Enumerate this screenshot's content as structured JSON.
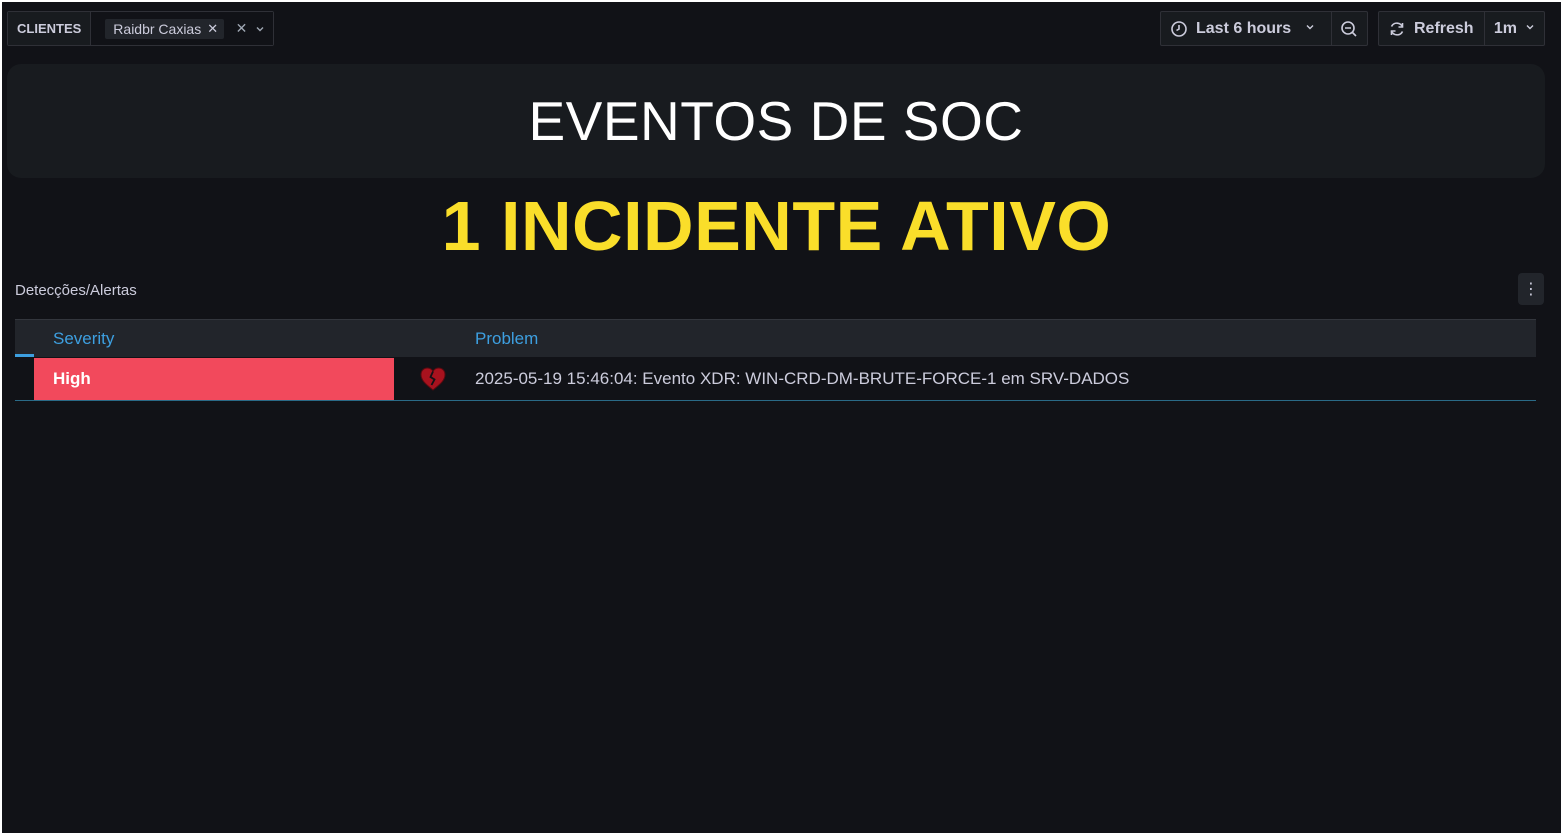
{
  "toolbar": {
    "variable_label": "CLIENTES",
    "variable_value": "Raidbr Caxias",
    "chip_remove": "✕",
    "clear_icon": "✕",
    "dropdown_icon": "⌄",
    "time_range": "Last 6 hours",
    "refresh_label": "Refresh",
    "refresh_interval": "1m"
  },
  "icons": {
    "clock": "clock-icon",
    "zoom_out": "zoom-out-icon",
    "refresh": "sync-icon",
    "severity": "broken-heart-icon"
  },
  "title_panel": {
    "title": "EVENTOS DE SOC"
  },
  "incident_stat": {
    "text": "1 INCIDENTE ATIVO",
    "color": "#fade2a"
  },
  "detections_panel": {
    "title": "Detecções/Alertas",
    "menu_icon": "⋮",
    "columns": [
      "Severity",
      "Problem"
    ],
    "rows": [
      {
        "severity": "High",
        "severity_color": "#f2495c",
        "problem": "2025-05-19 15:46:04: Evento XDR: WIN-CRD-DM-BRUTE-FORCE-1 em SRV-DADOS"
      }
    ]
  }
}
